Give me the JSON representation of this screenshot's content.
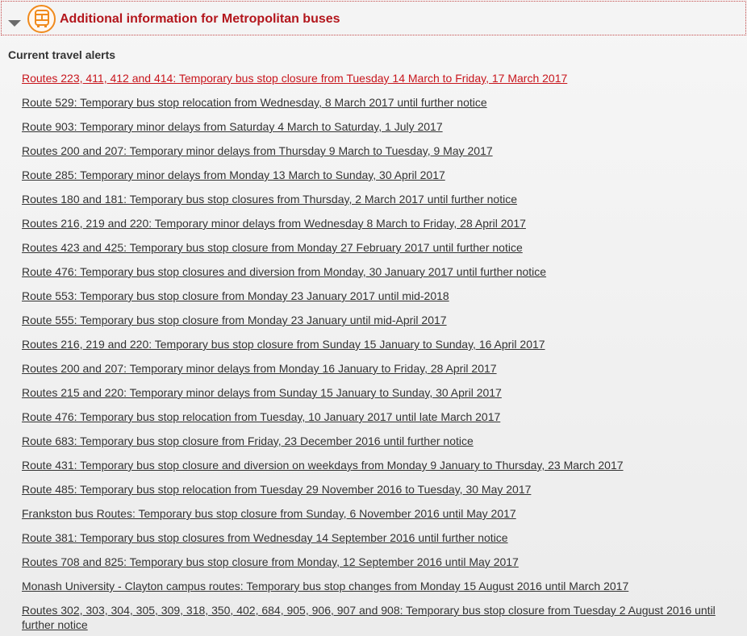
{
  "panel": {
    "title": "Additional information for Metropolitan buses",
    "icon": "bus-icon",
    "expand_icon": "chevron-down-icon",
    "accent_color": "#b3161c",
    "icon_color": "#f08a1c"
  },
  "section": {
    "title": "Current travel alerts"
  },
  "alerts": [
    "Routes 223, 411, 412 and 414: Temporary bus stop closure from Tuesday 14 March to Friday, 17 March 2017",
    "Route 529: Temporary bus stop relocation from Wednesday, 8 March 2017 until further notice",
    "Route 903: Temporary minor delays from Saturday 4 March to Saturday, 1 July 2017",
    "Routes 200 and 207: Temporary minor delays from Thursday 9 March to Tuesday, 9 May 2017",
    "Route 285: Temporary minor delays from Monday 13 March to Sunday, 30 April 2017",
    "Routes 180 and 181: Temporary bus stop closures from Thursday, 2 March 2017 until further notice",
    "Routes 216, 219 and 220: Temporary minor delays from Wednesday 8 March to Friday, 28 April 2017",
    "Routes 423 and 425: Temporary bus stop closure from Monday 27 February 2017 until further notice",
    "Route 476: Temporary bus stop closures and diversion from Monday, 30 January 2017 until further notice",
    "Route 553: Temporary bus stop closure from Monday 23 January 2017 until mid-2018",
    "Route 555: Temporary bus stop closure from Monday 23 January until mid-April 2017",
    "Routes 216, 219 and 220: Temporary bus stop closure from Sunday 15 January to Sunday, 16 April 2017",
    "Routes 200 and 207: Temporary minor delays from Monday 16 January to Friday, 28 April 2017",
    "Routes 215 and 220: Temporary minor delays from Sunday 15 January to Sunday, 30 April 2017",
    "Route 476: Temporary bus stop relocation from Tuesday, 10 January 2017 until late March 2017",
    "Route 683: Temporary bus stop closure from Friday, 23 December 2016 until further notice",
    "Route 431: Temporary bus stop closure and diversion on weekdays from Monday 9 January to Thursday, 23 March 2017",
    "Route 485: Temporary bus stop relocation from Tuesday 29 November 2016 to Tuesday, 30 May 2017",
    "Frankston bus Routes: Temporary bus stop closure from Sunday, 6 November 2016 until May 2017",
    "Route 381: Temporary bus stop closures from Wednesday 14 September 2016 until further notice",
    "Routes 708 and 825: Temporary bus stop closure from Monday, 12 September 2016 until May 2017",
    "Monash University - Clayton campus routes: Temporary bus stop changes from Monday 15 August 2016 until March 2017",
    "Routes 302, 303, 304, 305, 309, 318, 350, 402, 684, 905, 906, 907 and 908: Temporary bus stop closure from Tuesday 2 August 2016 until further notice"
  ]
}
